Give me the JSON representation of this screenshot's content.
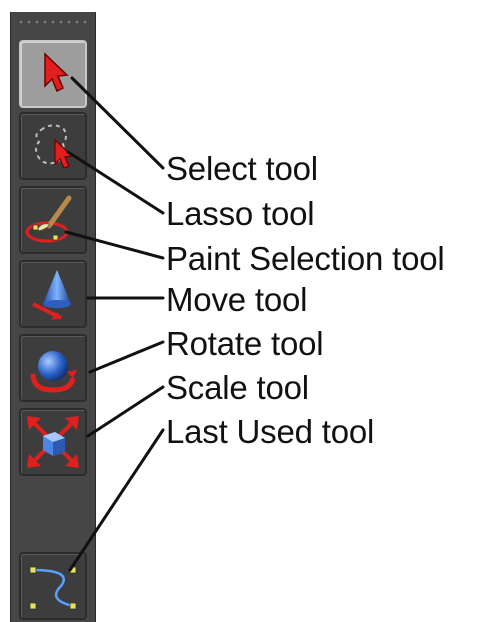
{
  "toolbox": {
    "tools": [
      {
        "id": "select",
        "label": "Select tool",
        "icon": "select-arrow-icon",
        "active": true
      },
      {
        "id": "lasso",
        "label": "Lasso tool",
        "icon": "lasso-icon",
        "active": false
      },
      {
        "id": "paint-selection",
        "label": "Paint Selection tool",
        "icon": "paint-selection-icon",
        "active": false
      },
      {
        "id": "move",
        "label": "Move tool",
        "icon": "move-icon",
        "active": false
      },
      {
        "id": "rotate",
        "label": "Rotate tool",
        "icon": "rotate-icon",
        "active": false
      },
      {
        "id": "scale",
        "label": "Scale tool",
        "icon": "scale-icon",
        "active": false
      },
      {
        "id": "last-used",
        "label": "Last Used tool",
        "icon": "curve-tool-icon",
        "active": false
      }
    ]
  },
  "colors": {
    "accent_red": "#e01f1f",
    "panel": "#464646",
    "active_button": "#9d9d9d"
  }
}
